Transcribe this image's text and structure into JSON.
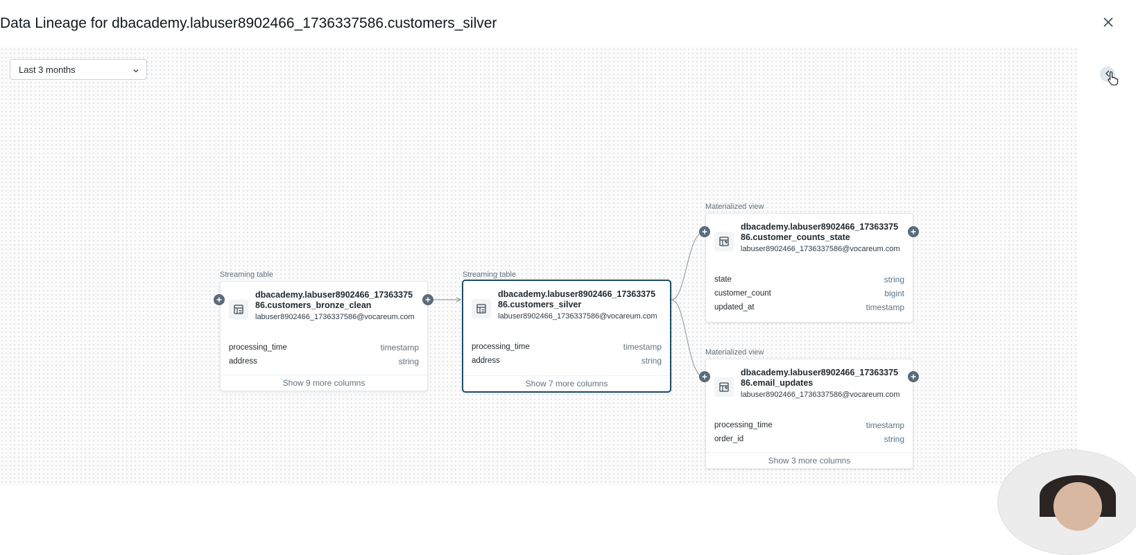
{
  "header": {
    "title": "Data Lineage for dbacademy.labuser8902466_1736337586.customers_silver",
    "close_icon": "close-icon"
  },
  "toolbar": {
    "time_range": "Last 3 months",
    "collapse_icon": "chevron-left-icon"
  },
  "colors": {
    "selected_border": "#1d4b63",
    "plus_button": "#5a6b7a",
    "canvas_dots": "#d9dcdf"
  },
  "nodes": [
    {
      "type_label": "Streaming table",
      "name": "dbacademy.labuser8902466_1736337586.customers_bronze_clean",
      "owner": "labuser8902466_1736337586@vocareum.com",
      "icon": "streaming-table-icon",
      "selected": false,
      "columns": [
        {
          "name": "processing_time",
          "type": "timestamp"
        },
        {
          "name": "address",
          "type": "string"
        }
      ],
      "show_more": "Show 9 more columns"
    },
    {
      "type_label": "Streaming table",
      "name": "dbacademy.labuser8902466_1736337586.customers_silver",
      "owner": "labuser8902466_1736337586@vocareum.com",
      "icon": "streaming-table-icon",
      "selected": true,
      "columns": [
        {
          "name": "processing_time",
          "type": "timestamp"
        },
        {
          "name": "address",
          "type": "string"
        }
      ],
      "show_more": "Show 7 more columns"
    },
    {
      "type_label": "Materialized view",
      "name": "dbacademy.labuser8902466_1736337586.customer_counts_state",
      "owner": "labuser8902466_1736337586@vocareum.com",
      "icon": "materialized-view-icon",
      "selected": false,
      "columns": [
        {
          "name": "state",
          "type": "string"
        },
        {
          "name": "customer_count",
          "type": "bigint"
        },
        {
          "name": "updated_at",
          "type": "timestamp"
        }
      ],
      "show_more": ""
    },
    {
      "type_label": "Materialized view",
      "name": "dbacademy.labuser8902466_1736337586.email_updates",
      "owner": "labuser8902466_1736337586@vocareum.com",
      "icon": "materialized-view-icon",
      "selected": false,
      "columns": [
        {
          "name": "processing_time",
          "type": "timestamp"
        },
        {
          "name": "order_id",
          "type": "string"
        }
      ],
      "show_more": "Show 3 more columns"
    }
  ]
}
